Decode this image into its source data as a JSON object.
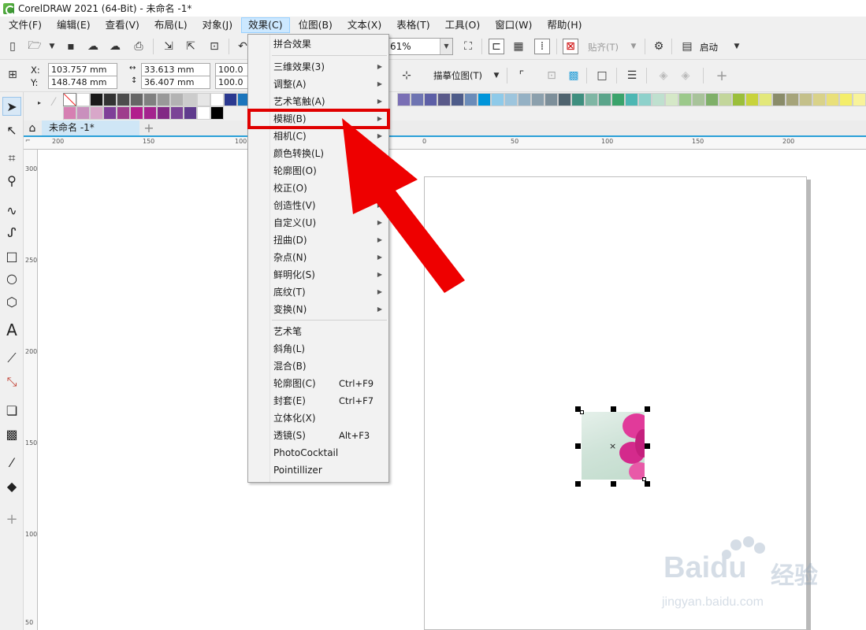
{
  "window": {
    "title": "CorelDRAW 2021 (64-Bit) - 未命名 -1*"
  },
  "menubar": {
    "items": [
      "文件(F)",
      "编辑(E)",
      "查看(V)",
      "布局(L)",
      "对象(J)",
      "效果(C)",
      "位图(B)",
      "文本(X)",
      "表格(T)",
      "工具(O)",
      "窗口(W)",
      "帮助(H)"
    ]
  },
  "toolbar": {
    "zoom": "61%",
    "align_label": "贴齐(T)",
    "launch_label": "启动"
  },
  "propbar": {
    "x_label": "X:",
    "x_value": "103.757 mm",
    "y_label": "Y:",
    "y_value": "148.748 mm",
    "w_value": "33.613 mm",
    "h_value": "36.407 mm",
    "scale_x": "100.0",
    "scale_y": "100.0",
    "trace_label": "描摹位图(T)"
  },
  "palette": {
    "row1": [
      "#ffffff",
      "#1a1a1a",
      "#333333",
      "#4d4d4d",
      "#666666",
      "#808080",
      "#999999",
      "#b3b3b3",
      "#cccccc",
      "#e6e6e6",
      "#ffffff",
      "#2b3990",
      "#1b75bc",
      "#0072bc"
    ],
    "row2": [
      "#d67fb2",
      "#c990bd",
      "#d8a7c9",
      "#7f3f98",
      "#9e3d8c",
      "#b21f8d",
      "#a4238e",
      "#822a85",
      "#7b4496",
      "#5f3b8d",
      "#ffffff",
      "#000000"
    ],
    "right": [
      "#7a6fb5",
      "#6e74b2",
      "#5d5fa6",
      "#5a5a8a",
      "#4e5c8a",
      "#6b8cb9",
      "#0095da",
      "#8ecae9",
      "#9dc5dd",
      "#95b1c4",
      "#8ca0ad",
      "#7d8f9a",
      "#4f636e",
      "#3f8f7f",
      "#7fb6a4",
      "#5ba58b",
      "#3aa36b",
      "#4db7b3",
      "#8ed1cb",
      "#bfe0cf",
      "#d5e8c7",
      "#9cc98b",
      "#a8c39a",
      "#7fb069",
      "#c3d69b",
      "#9bbf3b",
      "#c8d33c",
      "#e3e87a",
      "#8a8c6a",
      "#a6a47a",
      "#c4c08a",
      "#d9d289",
      "#e9e07a",
      "#f4ee6a",
      "#f8f39a"
    ]
  },
  "tabs": {
    "doc": "未命名 -1*",
    "add": "+"
  },
  "hruler": {
    "ticks": [
      "200",
      "150",
      "100",
      "0",
      "50",
      "100",
      "150",
      "200"
    ]
  },
  "vruler": {
    "ticks": [
      "300",
      "250",
      "200",
      "150",
      "100",
      "50"
    ]
  },
  "effects_menu": {
    "items": [
      {
        "label": "拼合效果",
        "arrow": false
      },
      {
        "label": "三维效果(3)",
        "arrow": true
      },
      {
        "label": "调整(A)",
        "arrow": true
      },
      {
        "label": "艺术笔触(A)",
        "arrow": true
      },
      {
        "label": "模糊(B)",
        "arrow": true
      },
      {
        "label": "相机(C)",
        "arrow": true
      },
      {
        "label": "颜色转换(L)",
        "arrow": true
      },
      {
        "label": "轮廓图(O)",
        "arrow": true
      },
      {
        "label": "校正(O)",
        "arrow": true
      },
      {
        "label": "创造性(V)",
        "arrow": true
      },
      {
        "label": "自定义(U)",
        "arrow": true
      },
      {
        "label": "扭曲(D)",
        "arrow": true
      },
      {
        "label": "杂点(N)",
        "arrow": true
      },
      {
        "label": "鲜明化(S)",
        "arrow": true
      },
      {
        "label": "底纹(T)",
        "arrow": true
      },
      {
        "label": "变换(N)",
        "arrow": true
      },
      {
        "label": "艺术笔",
        "arrow": false
      },
      {
        "label": "斜角(L)",
        "arrow": false
      },
      {
        "label": "混合(B)",
        "arrow": false
      },
      {
        "label": "轮廓图(C)",
        "shortcut": "Ctrl+F9"
      },
      {
        "label": "封套(E)",
        "shortcut": "Ctrl+F7"
      },
      {
        "label": "立体化(X)",
        "arrow": false
      },
      {
        "label": "透镜(S)",
        "shortcut": "Alt+F3"
      },
      {
        "label": "PhotoCocktail",
        "arrow": false
      },
      {
        "label": "Pointillizer",
        "arrow": false
      }
    ]
  },
  "watermark": {
    "brand": "Baidu",
    "cn": "经验",
    "url": "jingyan.baidu.com"
  }
}
